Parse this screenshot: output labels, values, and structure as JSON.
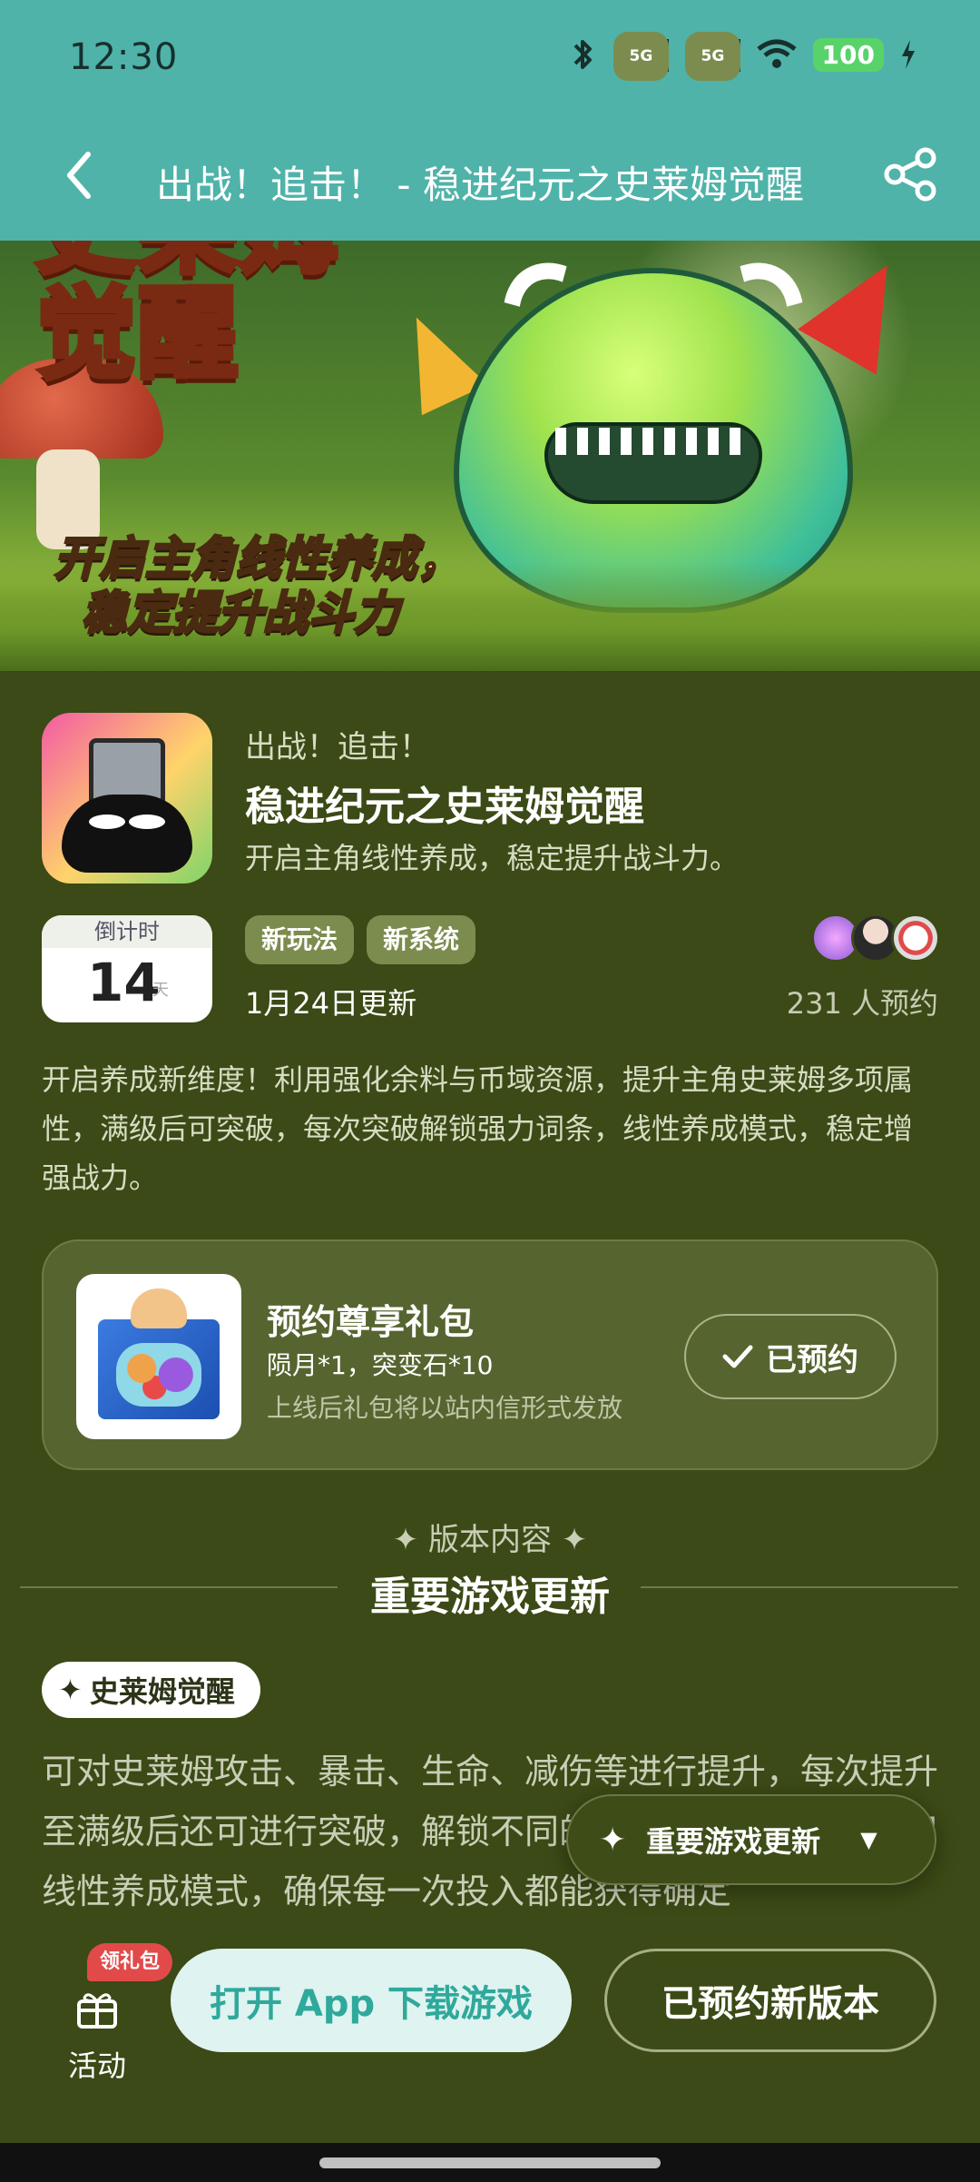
{
  "status_bar": {
    "time": "12:30",
    "signal_tag": "5G",
    "battery": "100",
    "icons": [
      "bluetooth-icon",
      "signal-5g-icon",
      "signal-5g-icon",
      "wifi-icon",
      "battery-icon",
      "charging-icon"
    ]
  },
  "header": {
    "title": "出战！追击！ - 稳进纪元之史莱姆觉醒",
    "background_color": "#4fb3a9"
  },
  "banner": {
    "headline_line1": "史莱姆",
    "headline_line2": "觉醒",
    "subline1": "开启主角线性养成，",
    "subline2": "稳定提升战斗力"
  },
  "game": {
    "subtitle": "出战！追击！",
    "name": "稳进纪元之史莱姆觉醒",
    "description": "开启主角线性养成，稳定提升战斗力。",
    "countdown_label": "倒计时",
    "countdown_value": "14",
    "countdown_unit": "天",
    "tags": [
      "新玩法",
      "新系统"
    ],
    "update_date": "1月24日更新",
    "reserve_count": "231 人预约",
    "intro": "开启养成新维度！利用强化余料与币域资源，提升主角史莱姆多项属性，满级后可突破，每次突破解锁强力词条，线性养成模式，稳定增强战力。"
  },
  "gift": {
    "title": "预约尊享礼包",
    "items": "陨月*1，突变石*10",
    "note": "上线后礼包将以站内信形式发放",
    "button_label": "已预约"
  },
  "section": {
    "subtitle": "✦ 版本内容 ✦",
    "title": "重要游戏更新",
    "chip_label": "史莱姆觉醒",
    "body": "可对史莱姆攻击、暴击、生命、减伤等进行提升，每次提升至满级后还可进行突破，解锁不同的强力词条。该玩法采用线性养成模式，确保每一次投入都能获得确定"
  },
  "floating_nav": {
    "label": "重要游戏更新"
  },
  "bottom_bar": {
    "activity_label": "活动",
    "badge": "领礼包",
    "open_app_label": "打开 App 下载游戏",
    "reserved_version_label": "已预约新版本"
  },
  "colors": {
    "page_bg": "#3b4a16",
    "accent_teal": "#4fb3a9",
    "tag_bg": "#7c8c4e",
    "badge_red": "#e24a4a"
  }
}
